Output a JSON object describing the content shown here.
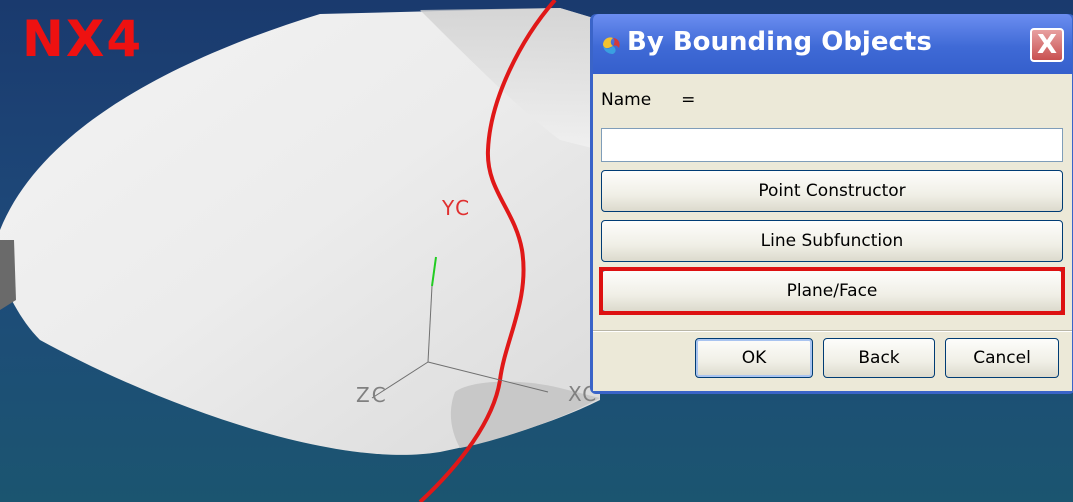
{
  "watermark": "NX4",
  "axes": {
    "yc": "YC",
    "zc": "ZC",
    "xc": "XC"
  },
  "dialog": {
    "title": "By Bounding Objects",
    "close_label": "X",
    "name_label": "Name",
    "name_equals": "=",
    "name_value": "",
    "buttons": {
      "point_constructor": "Point Constructor",
      "line_subfunction": "Line Subfunction",
      "plane_face": "Plane/Face"
    },
    "footer": {
      "ok": "OK",
      "back": "Back",
      "cancel": "Cancel"
    }
  },
  "colors": {
    "background": "#1e4a7a",
    "surface": "#eeeeee",
    "red_curve": "#e01818",
    "highlight": "#dd1111",
    "titlebar": "#3f6ad6",
    "dialog_body": "#ece9d8"
  }
}
